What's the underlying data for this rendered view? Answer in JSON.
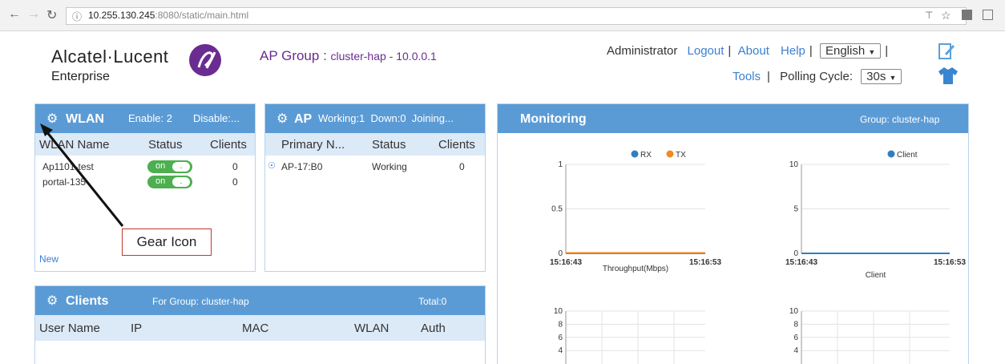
{
  "browser": {
    "url_host": "10.255.130.245",
    "url_rest": ":8080/static/main.html"
  },
  "header": {
    "logo_main": "Alcatel·Lucent",
    "logo_sub": "Enterprise",
    "ap_group_label": "AP Group :",
    "ap_group_value": "cluster-hap - 10.0.0.1",
    "user": "Administrator",
    "logout": "Logout",
    "about": "About",
    "help": "Help",
    "language": "English",
    "tools": "Tools",
    "polling_label": "Polling Cycle:",
    "polling_value": "30s"
  },
  "wlan": {
    "title": "WLAN",
    "enable": "Enable: 2",
    "disable": "Disable:...",
    "col_name": "WLAN Name",
    "col_status": "Status",
    "col_clients": "Clients",
    "rows": [
      {
        "name": "Ap1101-test",
        "status": "on",
        "clients": "0"
      },
      {
        "name": "portal-135",
        "status": "on",
        "clients": "0"
      }
    ],
    "new_link": "New"
  },
  "annotation": {
    "label": "Gear Icon"
  },
  "ap": {
    "title": "AP",
    "summary": "Working:1  Down:0  Joining...",
    "col_primary": "Primary N...",
    "col_status": "Status",
    "col_clients": "Clients",
    "rows": [
      {
        "name": "AP-17:B0",
        "status": "Working",
        "clients": "0"
      }
    ]
  },
  "clients": {
    "title": "Clients",
    "group": "For Group: cluster-hap",
    "total": "Total:0",
    "cols": [
      "User Name",
      "IP",
      "MAC",
      "WLAN",
      "Auth"
    ]
  },
  "monitoring": {
    "title": "Monitoring",
    "group": "Group: cluster-hap"
  },
  "chart_data": [
    {
      "type": "line",
      "title": "",
      "xlabel": "Throughput(Mbps)",
      "x": [
        "15:16:43",
        "15:16:53"
      ],
      "series": [
        {
          "name": "RX",
          "color": "#2f7fc1",
          "values": [
            0,
            0
          ]
        },
        {
          "name": "TX",
          "color": "#f08a24",
          "values": [
            0,
            0
          ]
        }
      ],
      "ylim": [
        0,
        1
      ],
      "yticks": [
        "0",
        "0.5",
        "1"
      ],
      "legend": "top-right"
    },
    {
      "type": "line",
      "title": "",
      "xlabel": "Client",
      "x": [
        "15:16:43",
        "15:16:53"
      ],
      "series": [
        {
          "name": "Client",
          "color": "#2f7fc1",
          "values": [
            0,
            0
          ]
        }
      ],
      "ylim": [
        0,
        10
      ],
      "yticks": [
        "0",
        "5",
        "10"
      ],
      "legend": "top-right"
    },
    {
      "type": "line",
      "title": "",
      "xlabel": "",
      "x": [],
      "series": [],
      "ylim": [
        0,
        10
      ],
      "yticks": [
        "4",
        "6",
        "8",
        "10"
      ],
      "legend": "none"
    },
    {
      "type": "line",
      "title": "",
      "xlabel": "",
      "x": [],
      "series": [],
      "ylim": [
        0,
        10
      ],
      "yticks": [
        "4",
        "6",
        "8",
        "10"
      ],
      "legend": "none"
    }
  ]
}
